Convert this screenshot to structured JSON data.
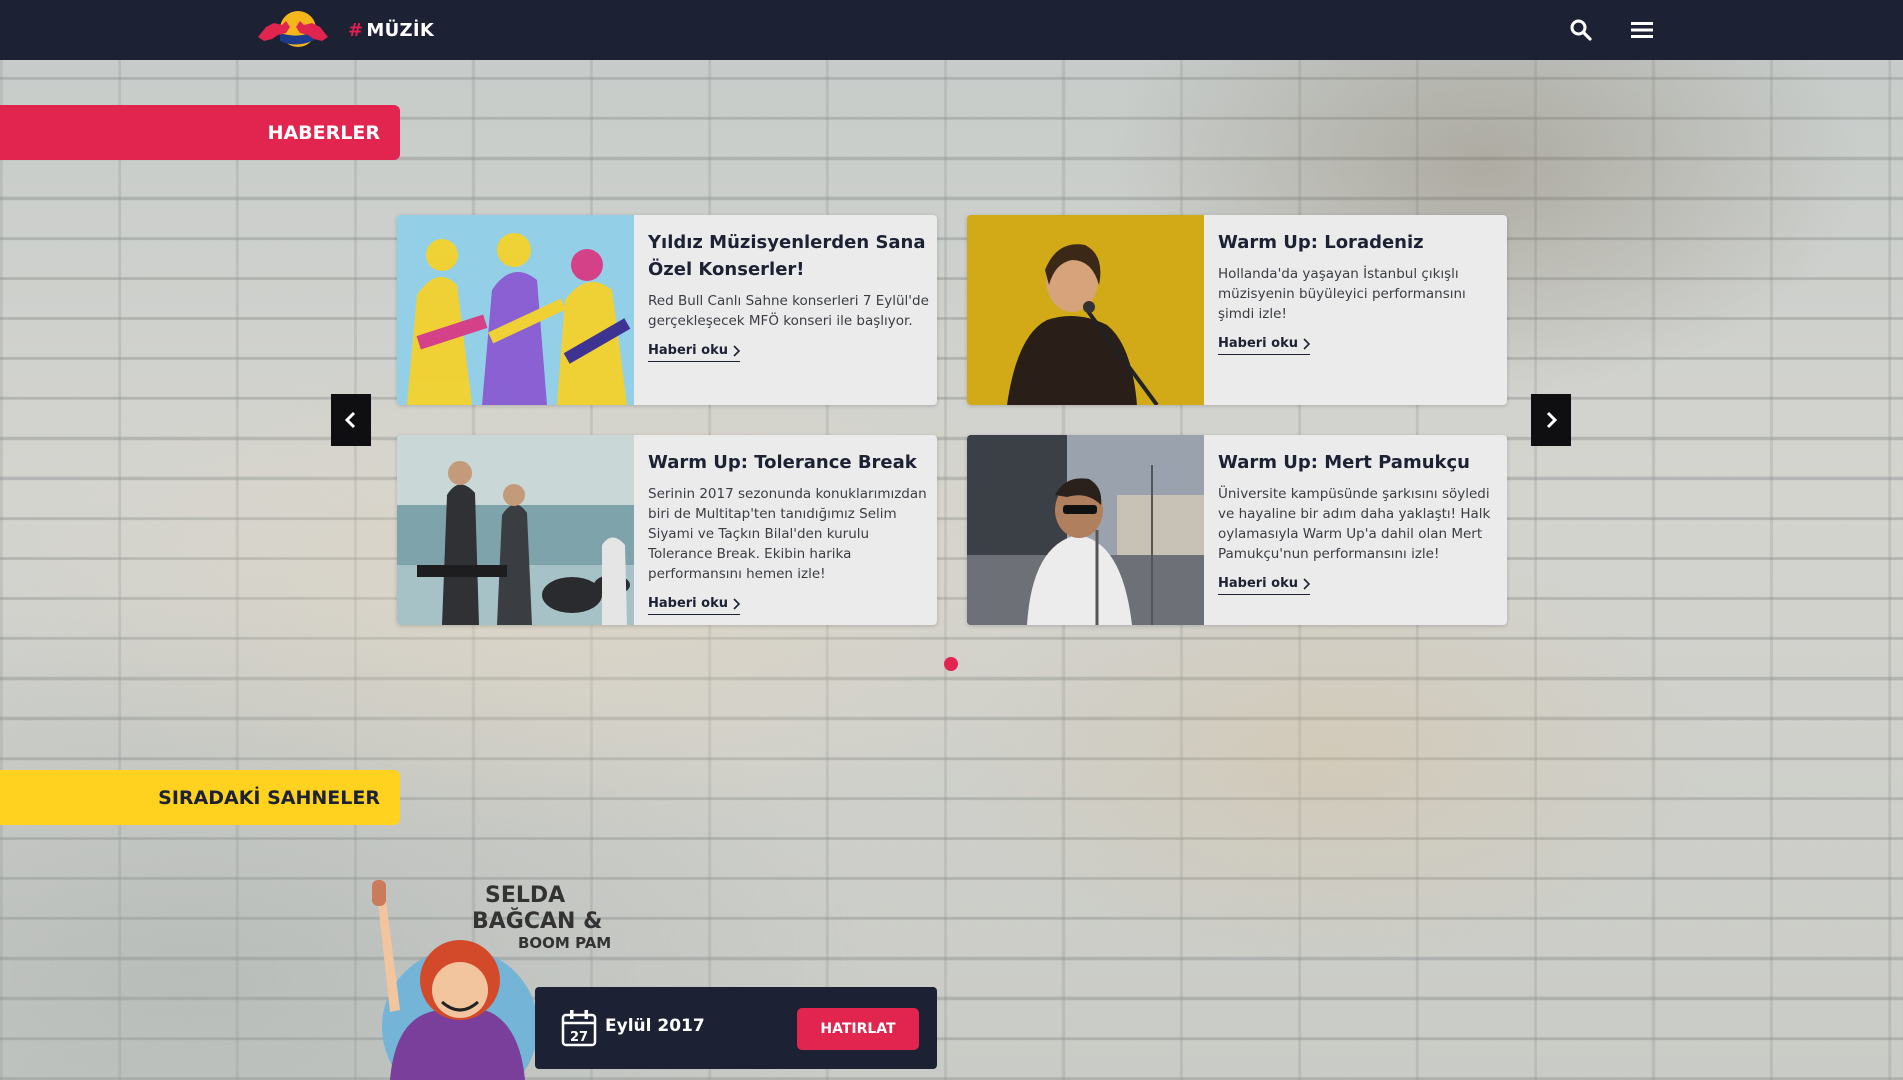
{
  "header": {
    "section_hash": "#",
    "section_name": "MÜZİK",
    "logo_icon": "red-bull-logo",
    "search_icon": "search-icon",
    "menu_icon": "hamburger-menu-icon"
  },
  "news": {
    "banner_label": "HABERLER",
    "prev_icon": "chevron-left-icon",
    "next_icon": "chevron-right-icon",
    "cards": [
      {
        "title": "Yıldız Müzisyenlerden Sana Özel Konserler!",
        "description": "Red Bull Canlı Sahne konserleri 7 Eylül'de gerçekleşecek MFÖ konseri ile başlıyor.",
        "read_more": "Haberi oku"
      },
      {
        "title": "Warm Up: Loradeniz",
        "description": "Hollanda'da yaşayan İstanbul çıkışlı müzisyenin büyüleyici performansını şimdi izle!",
        "read_more": "Haberi oku"
      },
      {
        "title": "Warm Up: Tolerance Break",
        "description": "Serinin 2017 sezonunda konuklarımızdan biri de Multitap'ten tanıdığımız Selim Siyami ve Taçkın Bilal'den kurulu Tolerance Break. Ekibin harika performansını hemen izle!",
        "read_more": "Haberi oku"
      },
      {
        "title": "Warm Up: Mert Pamukçu",
        "description": "Üniversite kampüsünde şarkısını söyledi ve hayaline bir adım daha yaklaştı! Halk oylamasıyla Warm Up'a dahil olan Mert Pamukçu'nun performansını izle!",
        "read_more": "Haberi oku"
      }
    ]
  },
  "upcoming": {
    "banner_label": "SIRADAKİ SAHNELER",
    "poster_title_line1": "SELDA",
    "poster_title_line2": "BAĞCAN &",
    "poster_title_line3": "BOOM PAM",
    "calendar_day": "27",
    "date_label": "Eylül 2017",
    "remind_button": "HATIRLAT"
  },
  "colors": {
    "nav_bg": "#1c2233",
    "accent_red": "#e2254f",
    "accent_yellow": "#ffd21f"
  }
}
